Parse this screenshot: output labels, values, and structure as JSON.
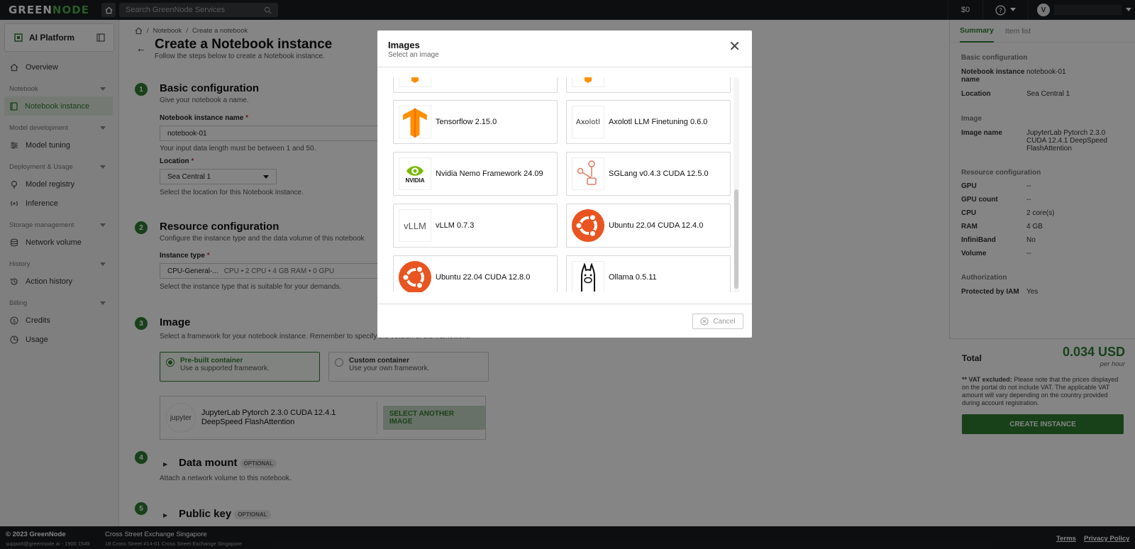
{
  "topbar": {
    "logo_a": "GREEN",
    "logo_b": "NODE",
    "search_placeholder": "Search GreenNode Services",
    "credit": "$0",
    "avatar": "V"
  },
  "sidebar": {
    "platform": "AI Platform",
    "overview": "Overview",
    "sec_notebook": "Notebook",
    "notebook_instance": "Notebook instance",
    "sec_model_dev": "Model development",
    "model_tuning": "Model tuning",
    "sec_deploy": "Deployment & Usage",
    "model_registry": "Model registry",
    "inference": "Inference",
    "sec_storage": "Storage management",
    "network_volume": "Network volume",
    "sec_history": "History",
    "action_history": "Action history",
    "sec_billing": "Billing",
    "credits": "Credits",
    "usage": "Usage"
  },
  "main": {
    "crumb1": "Notebook",
    "crumb2": "Create a notebook",
    "title": "Create a Notebook instance",
    "subtitle": "Follow the steps below to create a Notebook instance.",
    "s1_num": "1",
    "s1_title": "Basic configuration",
    "s1_sub": "Give your notebook a name.",
    "name_label": "Notebook instance name",
    "name_value": "notebook-01",
    "name_hint": "Your input data length must be between 1 and 50.",
    "loc_label": "Location",
    "loc_value": "Sea Central 1",
    "loc_hint": "Select the location for this Notebook instance.",
    "s2_num": "2",
    "s2_title": "Resource configuration",
    "s2_sub": "Configure the instance type and the data volume of this notebook",
    "type_label": "Instance type",
    "type_value": "CPU-General-...",
    "type_detail": "CPU • 2 CPU • 4 GB RAM • 0 GPU",
    "type_hint": "Select the instance type that is suitable for your demands.",
    "s3_num": "3",
    "s3_title": "Image",
    "s3_sub": "Select a framework for your notebook instance. Remember to specify the version of the framework.",
    "prebuilt_t": "Pre-built container",
    "prebuilt_s": "Use a supported framework.",
    "custom_t": "Custom container",
    "custom_s": "Use your own framework.",
    "sel_icon": "jupyter",
    "sel_name": "JupyterLab Pytorch 2.3.0 CUDA 12.4.1 DeepSpeed FlashAttention",
    "sel_btn": "SELECT ANOTHER IMAGE",
    "s4_num": "4",
    "s4_title": "Data mount",
    "s4_opt": "OPTIONAL",
    "s4_sub": "Attach a network volume to this notebook.",
    "s5_num": "5",
    "s5_title": "Public key",
    "s5_opt": "OPTIONAL"
  },
  "summary": {
    "tab1": "Summary",
    "tab2": "Item list",
    "g1": "Basic configuration",
    "k_name": "Notebook instance name",
    "v_name": "notebook-01",
    "k_loc": "Location",
    "v_loc": "Sea Central 1",
    "g2": "Image",
    "k_img": "Image name",
    "v_img": "JupyterLab Pytorch 2.3.0 CUDA 12.4.1 DeepSpeed FlashAttention",
    "g3": "Resource configuration",
    "k_gpu": "GPU",
    "v_gpu": "--",
    "k_gpuc": "GPU count",
    "v_gpuc": "--",
    "k_cpu": "CPU",
    "v_cpu": "2 core(s)",
    "k_ram": "RAM",
    "v_ram": "4 GB",
    "k_ib": "InfiniBand",
    "v_ib": "No",
    "k_vol": "Volume",
    "v_vol": "--",
    "g4": "Authorization",
    "k_iam": "Protected by IAM",
    "v_iam": "Yes",
    "total_label": "Total",
    "total_value": "0.034 USD",
    "total_unit": "per hour",
    "vat_bold": "** VAT excluded:",
    "vat_text": " Please note that the prices displayed on the portal do not include VAT. The applicable VAT amount will vary depending on the country provided during account registration.",
    "create": "CREATE INSTANCE"
  },
  "footer": {
    "copyright": "© 2023 GreenNode",
    "contact": "support@greennode.ai - 1900 1549",
    "addr1": "Cross Street Exchange Singapore",
    "addr2": "18 Cross Street #14-01 Cross Street Exchange Singapore",
    "terms": "Terms",
    "privacy": "Privacy Policy"
  },
  "modal": {
    "title": "Images",
    "subtitle": "Select an image",
    "cancel": "Cancel",
    "images": [
      {
        "name": "Tensorflow 2.15.0",
        "icon": "tensorflow-icon"
      },
      {
        "name": "Axolotl LLM Finetuning 0.6.0",
        "icon": "axolotl-icon",
        "logo_text": "Axolotl"
      },
      {
        "name": "Nvidia Nemo Framework 24.09",
        "icon": "nvidia-icon",
        "logo_text": "NVIDIA"
      },
      {
        "name": "SGLang v0.4.3 CUDA 12.5.0",
        "icon": "sglang-icon"
      },
      {
        "name": "vLLM 0.7.3",
        "icon": "vllm-icon",
        "logo_text": "vLLM"
      },
      {
        "name": "Ubuntu 22.04 CUDA 12.4.0",
        "icon": "ubuntu-icon"
      },
      {
        "name": "Ubuntu 22.04 CUDA 12.8.0",
        "icon": "ubuntu-icon"
      },
      {
        "name": "Ollama 0.5.11",
        "icon": "ollama-icon"
      }
    ]
  },
  "colors": {
    "brand": "#2e7d32",
    "tensorflow": "#ff8f00",
    "ubuntu": "#e95420",
    "nvidia": "#76b900"
  }
}
